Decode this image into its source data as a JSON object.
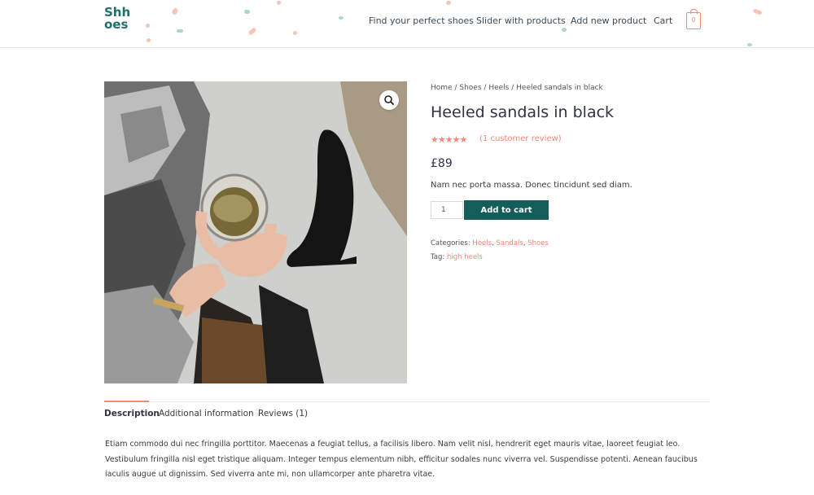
{
  "header": {
    "logo_line1": "Shh",
    "logo_line2": "oes",
    "nav": [
      "Find your perfect shoes",
      "Slider with products",
      "Add new product",
      "Cart"
    ],
    "cart_count": "0"
  },
  "product": {
    "breadcrumb": [
      "Home",
      "Shoes",
      "Heels",
      "Heeled sandals in black"
    ],
    "breadcrumb_sep": "/",
    "title": "Heeled sandals in black",
    "rating_stars": "★★★★★",
    "rating": 5,
    "review_link": "(1 customer review)",
    "price": "£89",
    "short_description": "Nam nec porta massa. Donec tincidunt sed diam.",
    "quantity": "1",
    "add_to_cart": "Add to cart",
    "categories_label": "Categories:",
    "categories": [
      "Heels",
      "Sandals",
      "Shoes"
    ],
    "tag_label": "Tag:",
    "tag": "high heels"
  },
  "tabs": [
    "Description",
    "Additional information",
    "Reviews (1)"
  ],
  "description": "Etiam commodo dui nec fringilla porttitor. Maecenas a feugiat tellus, a facilisis libero. Nam velit nisl, hendrerit eget mauris vitae, laoreet feugiat leo. Vestibulum fringilla nisl eget tristique aliquam. Integer tempus elementum nibh, efficitur sodales nunc viverra vel. Suspendisse potenti. Aenean faucibus iaculis augue ut dignissim. Sed viverra ante mi, non ullamcorper ante pharetra vitae.",
  "colors": {
    "accent": "#f0897a",
    "brand": "#1f6f6a",
    "button": "#135e5b"
  }
}
